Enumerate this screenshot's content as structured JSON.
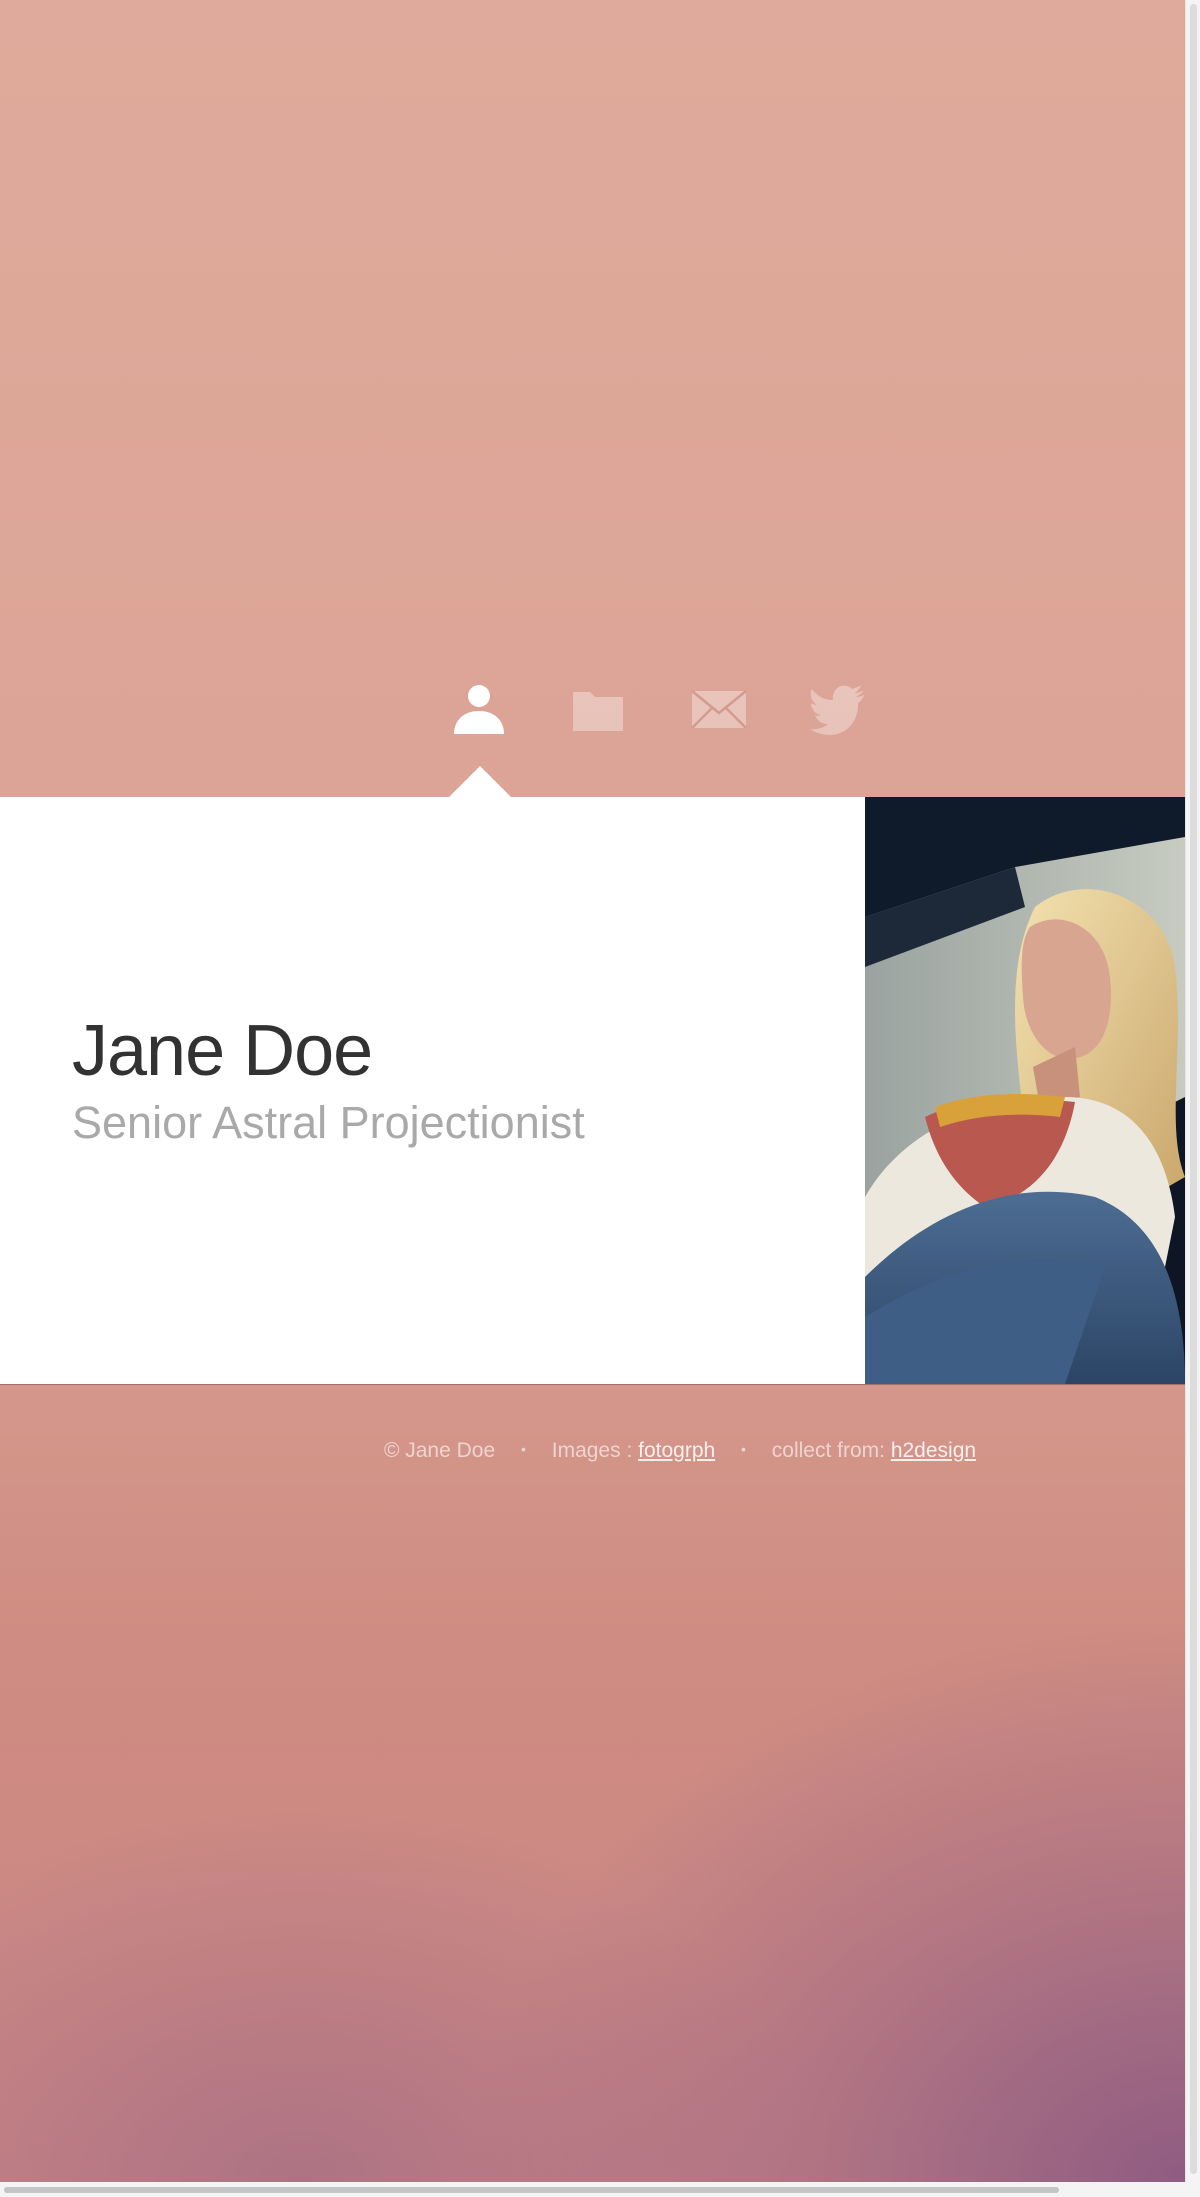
{
  "nav": {
    "items": [
      {
        "icon": "user-icon",
        "active": true
      },
      {
        "icon": "folder-icon",
        "active": false
      },
      {
        "icon": "envelope-icon",
        "active": false
      },
      {
        "icon": "twitter-bird-icon",
        "active": false
      }
    ]
  },
  "profile": {
    "name": "Jane Doe",
    "title": "Senior Astral Projectionist",
    "photo": "portrait-photo"
  },
  "footer": {
    "copyright": "© Jane Doe",
    "separator": "•",
    "images_label": "Images : ",
    "images_link": "fotogrph",
    "collect_label": "collect from: ",
    "collect_link": "h2design"
  },
  "colors": {
    "background_top": "#dfaa9b",
    "background_bottom": "#8c5a82",
    "card": "#ffffff",
    "name_text": "#323232",
    "title_text": "#a9a9a9"
  }
}
